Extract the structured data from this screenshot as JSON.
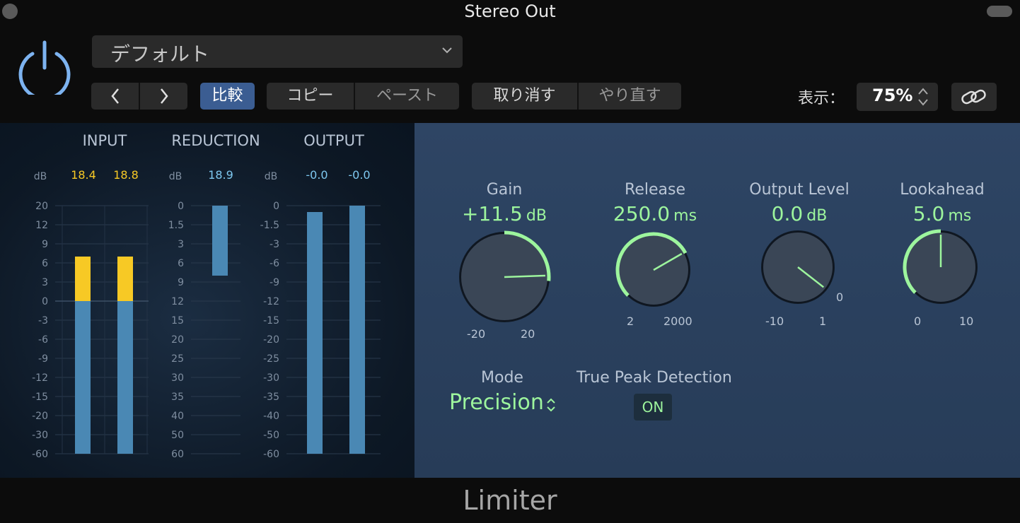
{
  "window": {
    "title": "Stereo Out"
  },
  "header": {
    "preset": "デフォルト",
    "compare": "比較",
    "copy": "コピー",
    "paste": "ペースト",
    "undo": "取り消す",
    "redo": "やり直す",
    "view_label": "表示：",
    "zoom": "75%"
  },
  "meters": {
    "sections": [
      "INPUT",
      "REDUCTION",
      "OUTPUT"
    ],
    "db_label": "dB",
    "input": {
      "peaks": [
        "18.4",
        "18.8"
      ],
      "scale": [
        "20",
        "12",
        "9",
        "6",
        "3",
        "0",
        "-3",
        "-6",
        "-9",
        "-12",
        "-15",
        "-20",
        "-30",
        "-60"
      ],
      "levels": [
        7,
        7
      ]
    },
    "reduction": {
      "peak": "18.9",
      "scale": [
        "0",
        "1.5",
        "3",
        "6",
        "9",
        "12",
        "15",
        "20",
        "25",
        "30",
        "35",
        "40",
        "50",
        "60"
      ],
      "level": 8
    },
    "output": {
      "peaks": [
        "-0.0",
        "-0.0"
      ],
      "scale": [
        "0",
        "-1.5",
        "-3",
        "-6",
        "-9",
        "-12",
        "-15",
        "-20",
        "-25",
        "-30",
        "-35",
        "-40",
        "-50",
        "-60"
      ],
      "levels": [
        -0.5,
        0
      ]
    },
    "colors": {
      "signal": "#4a88b4",
      "over": "#f7c925",
      "peak_input": "#f7c925",
      "peak_other": "#7ec8f0"
    }
  },
  "controls": {
    "gain": {
      "label": "Gain",
      "value": "+11.5",
      "unit": "dB",
      "min": "-20",
      "max": "20"
    },
    "release": {
      "label": "Release",
      "value": "250.0",
      "unit": "ms",
      "min": "2",
      "max": "2000"
    },
    "output_level": {
      "label": "Output Level",
      "value": "0.0",
      "unit": "dB",
      "min": "-10",
      "max": "1",
      "marker": "0"
    },
    "lookahead": {
      "label": "Lookahead",
      "value": "5.0",
      "unit": "ms",
      "min": "0",
      "max": "10"
    },
    "mode": {
      "label": "Mode",
      "value": "Precision"
    },
    "true_peak": {
      "label": "True Peak Detection",
      "state": "ON"
    },
    "accent": "#9df59d"
  },
  "footer": {
    "plugin": "Limiter"
  }
}
